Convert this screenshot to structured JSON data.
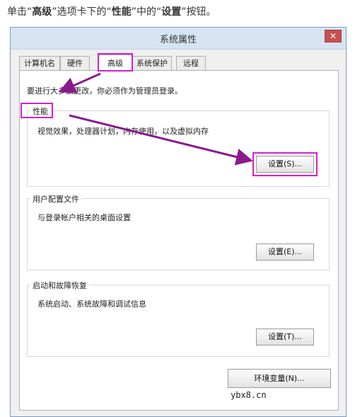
{
  "instruction": {
    "prefix": "单击“",
    "tab_name": "高级",
    "mid1": "”选项卡下的“",
    "section_name": "性能",
    "mid2": "”中的“",
    "button_name": "设置",
    "suffix": "”按钮。"
  },
  "window": {
    "title": "系统属性",
    "close_glyph": "✕"
  },
  "tabs": [
    {
      "label": "计算机名"
    },
    {
      "label": "硬件"
    },
    {
      "label": "高级"
    },
    {
      "label": "系统保护"
    },
    {
      "label": "远程"
    }
  ],
  "active_tab": "高级",
  "admin_note": "要进行大多数更改，你必须作为管理员登录。",
  "groups": {
    "performance": {
      "title": "性能",
      "description": "视觉效果，处理器计划，内存使用，以及虚拟内存",
      "button": "设置(S)..."
    },
    "user_profiles": {
      "title": "用户配置文件",
      "description": "与登录帐户相关的桌面设置",
      "button": "设置(E)..."
    },
    "startup_recovery": {
      "title": "启动和故障恢复",
      "description": "系统启动、系统故障和调试信息",
      "button": "设置(T)..."
    }
  },
  "env_button": "环境变量(N)...",
  "watermark": "ybx8.cn",
  "colors": {
    "highlight": "#d21fd2",
    "arrow": "#8b1a8b",
    "titlebar": "#d6e4f2",
    "close": "#c75050"
  }
}
